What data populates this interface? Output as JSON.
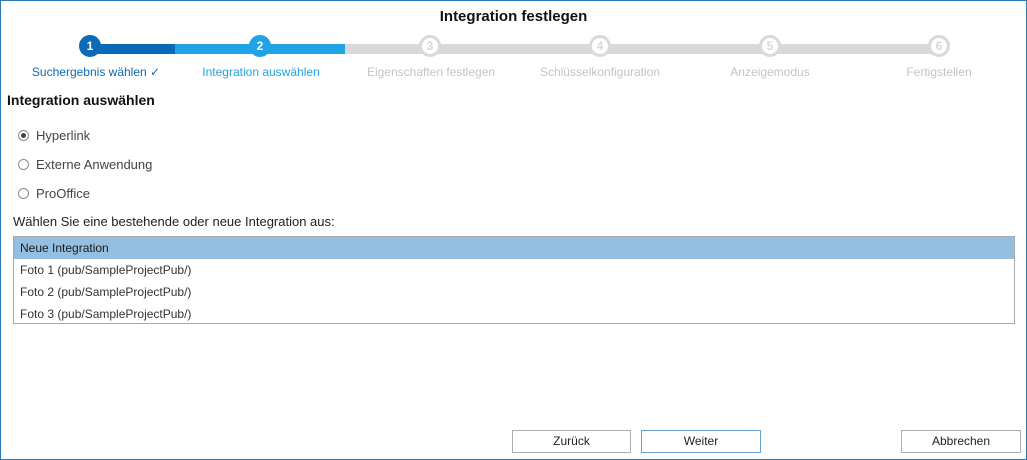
{
  "dialog": {
    "title": "Integration festlegen"
  },
  "colors": {
    "accent_dark": "#0a6ab8",
    "accent_light": "#21a4e6",
    "inactive": "#d9d9d9",
    "selection": "#94bfe1"
  },
  "wizard": {
    "steps": [
      {
        "number": "1",
        "label": "Suchergebnis wählen ✓",
        "state": "completed"
      },
      {
        "number": "2",
        "label": "Integration auswählen",
        "state": "current"
      },
      {
        "number": "3",
        "label": "Eigenschaften festlegen",
        "state": "upcoming"
      },
      {
        "number": "4",
        "label": "Schlüsselkonfiguration",
        "state": "upcoming"
      },
      {
        "number": "5",
        "label": "Anzeigemodus",
        "state": "upcoming"
      },
      {
        "number": "6",
        "label": "Fertigstellen",
        "state": "upcoming"
      }
    ]
  },
  "main": {
    "section_title": "Integration auswählen",
    "options": [
      {
        "label": "Hyperlink",
        "checked": true
      },
      {
        "label": "Externe Anwendung",
        "checked": false
      },
      {
        "label": "ProOffice",
        "checked": false
      }
    ],
    "list_prompt": "Wählen Sie eine bestehende oder neue Integration aus:",
    "list_items": [
      {
        "label": "Neue Integration",
        "selected": true
      },
      {
        "label": "Foto 1 (pub/SampleProjectPub/)",
        "selected": false
      },
      {
        "label": "Foto 2 (pub/SampleProjectPub/)",
        "selected": false
      },
      {
        "label": "Foto 3 (pub/SampleProjectPub/)",
        "selected": false
      }
    ]
  },
  "footer": {
    "back_label": "Zurück",
    "next_label": "Weiter",
    "cancel_label": "Abbrechen"
  }
}
